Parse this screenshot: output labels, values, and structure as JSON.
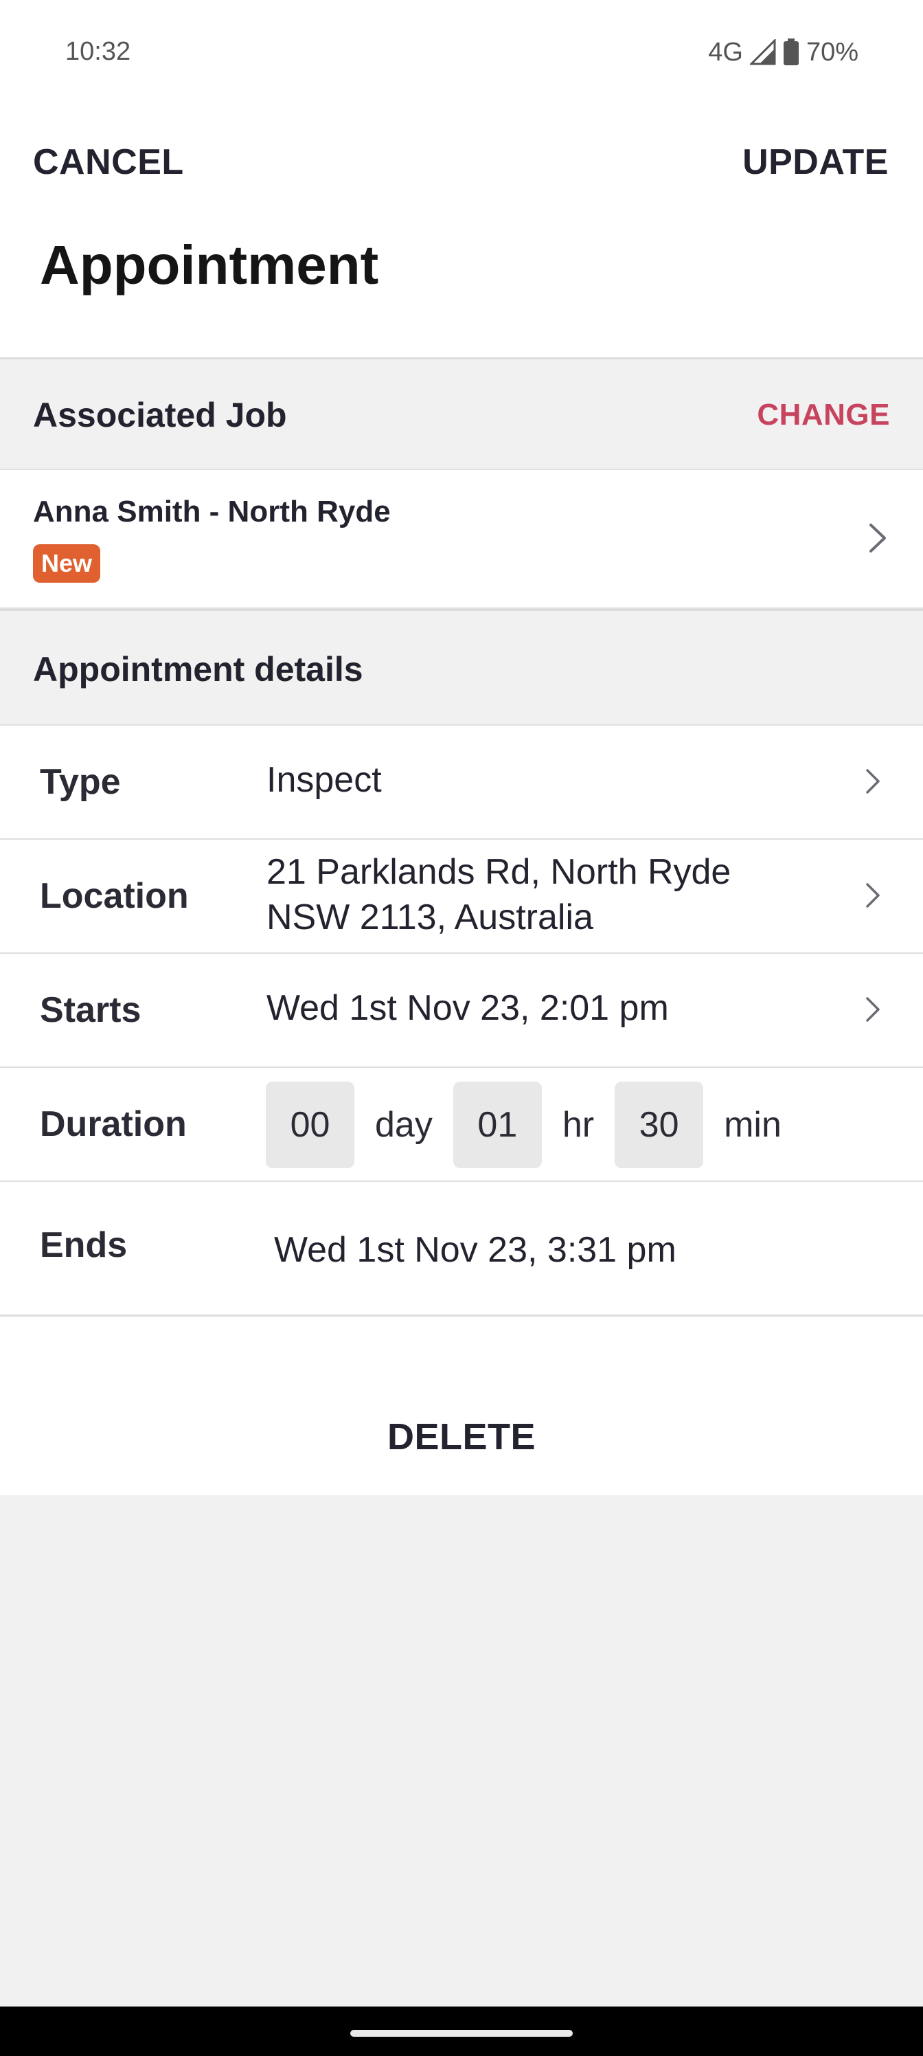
{
  "status_bar": {
    "time": "10:32",
    "network": "4G",
    "battery": "70%"
  },
  "top_bar": {
    "cancel_label": "CANCEL",
    "update_label": "UPDATE"
  },
  "title": "Appointment",
  "associated_job": {
    "header": "Associated Job",
    "change_label": "CHANGE",
    "job_name": "Anna Smith - North Ryde",
    "badge": "New"
  },
  "details": {
    "header": "Appointment details",
    "type": {
      "label": "Type",
      "value": "Inspect"
    },
    "location": {
      "label": "Location",
      "line1": "21 Parklands Rd, North Ryde",
      "line2": "NSW 2113, Australia"
    },
    "starts": {
      "label": "Starts",
      "value": "Wed 1st Nov 23, 2:01 pm"
    },
    "duration": {
      "label": "Duration",
      "day_value": "00",
      "day_unit": "day",
      "hr_value": "01",
      "hr_unit": "hr",
      "min_value": "30",
      "min_unit": "min"
    },
    "ends": {
      "label": "Ends",
      "value": "Wed 1st Nov 23, 3:31 pm"
    }
  },
  "delete_label": "DELETE",
  "colors": {
    "accent": "#c7435e",
    "badge": "#e0612f",
    "section_bg": "#f1f1f1"
  }
}
